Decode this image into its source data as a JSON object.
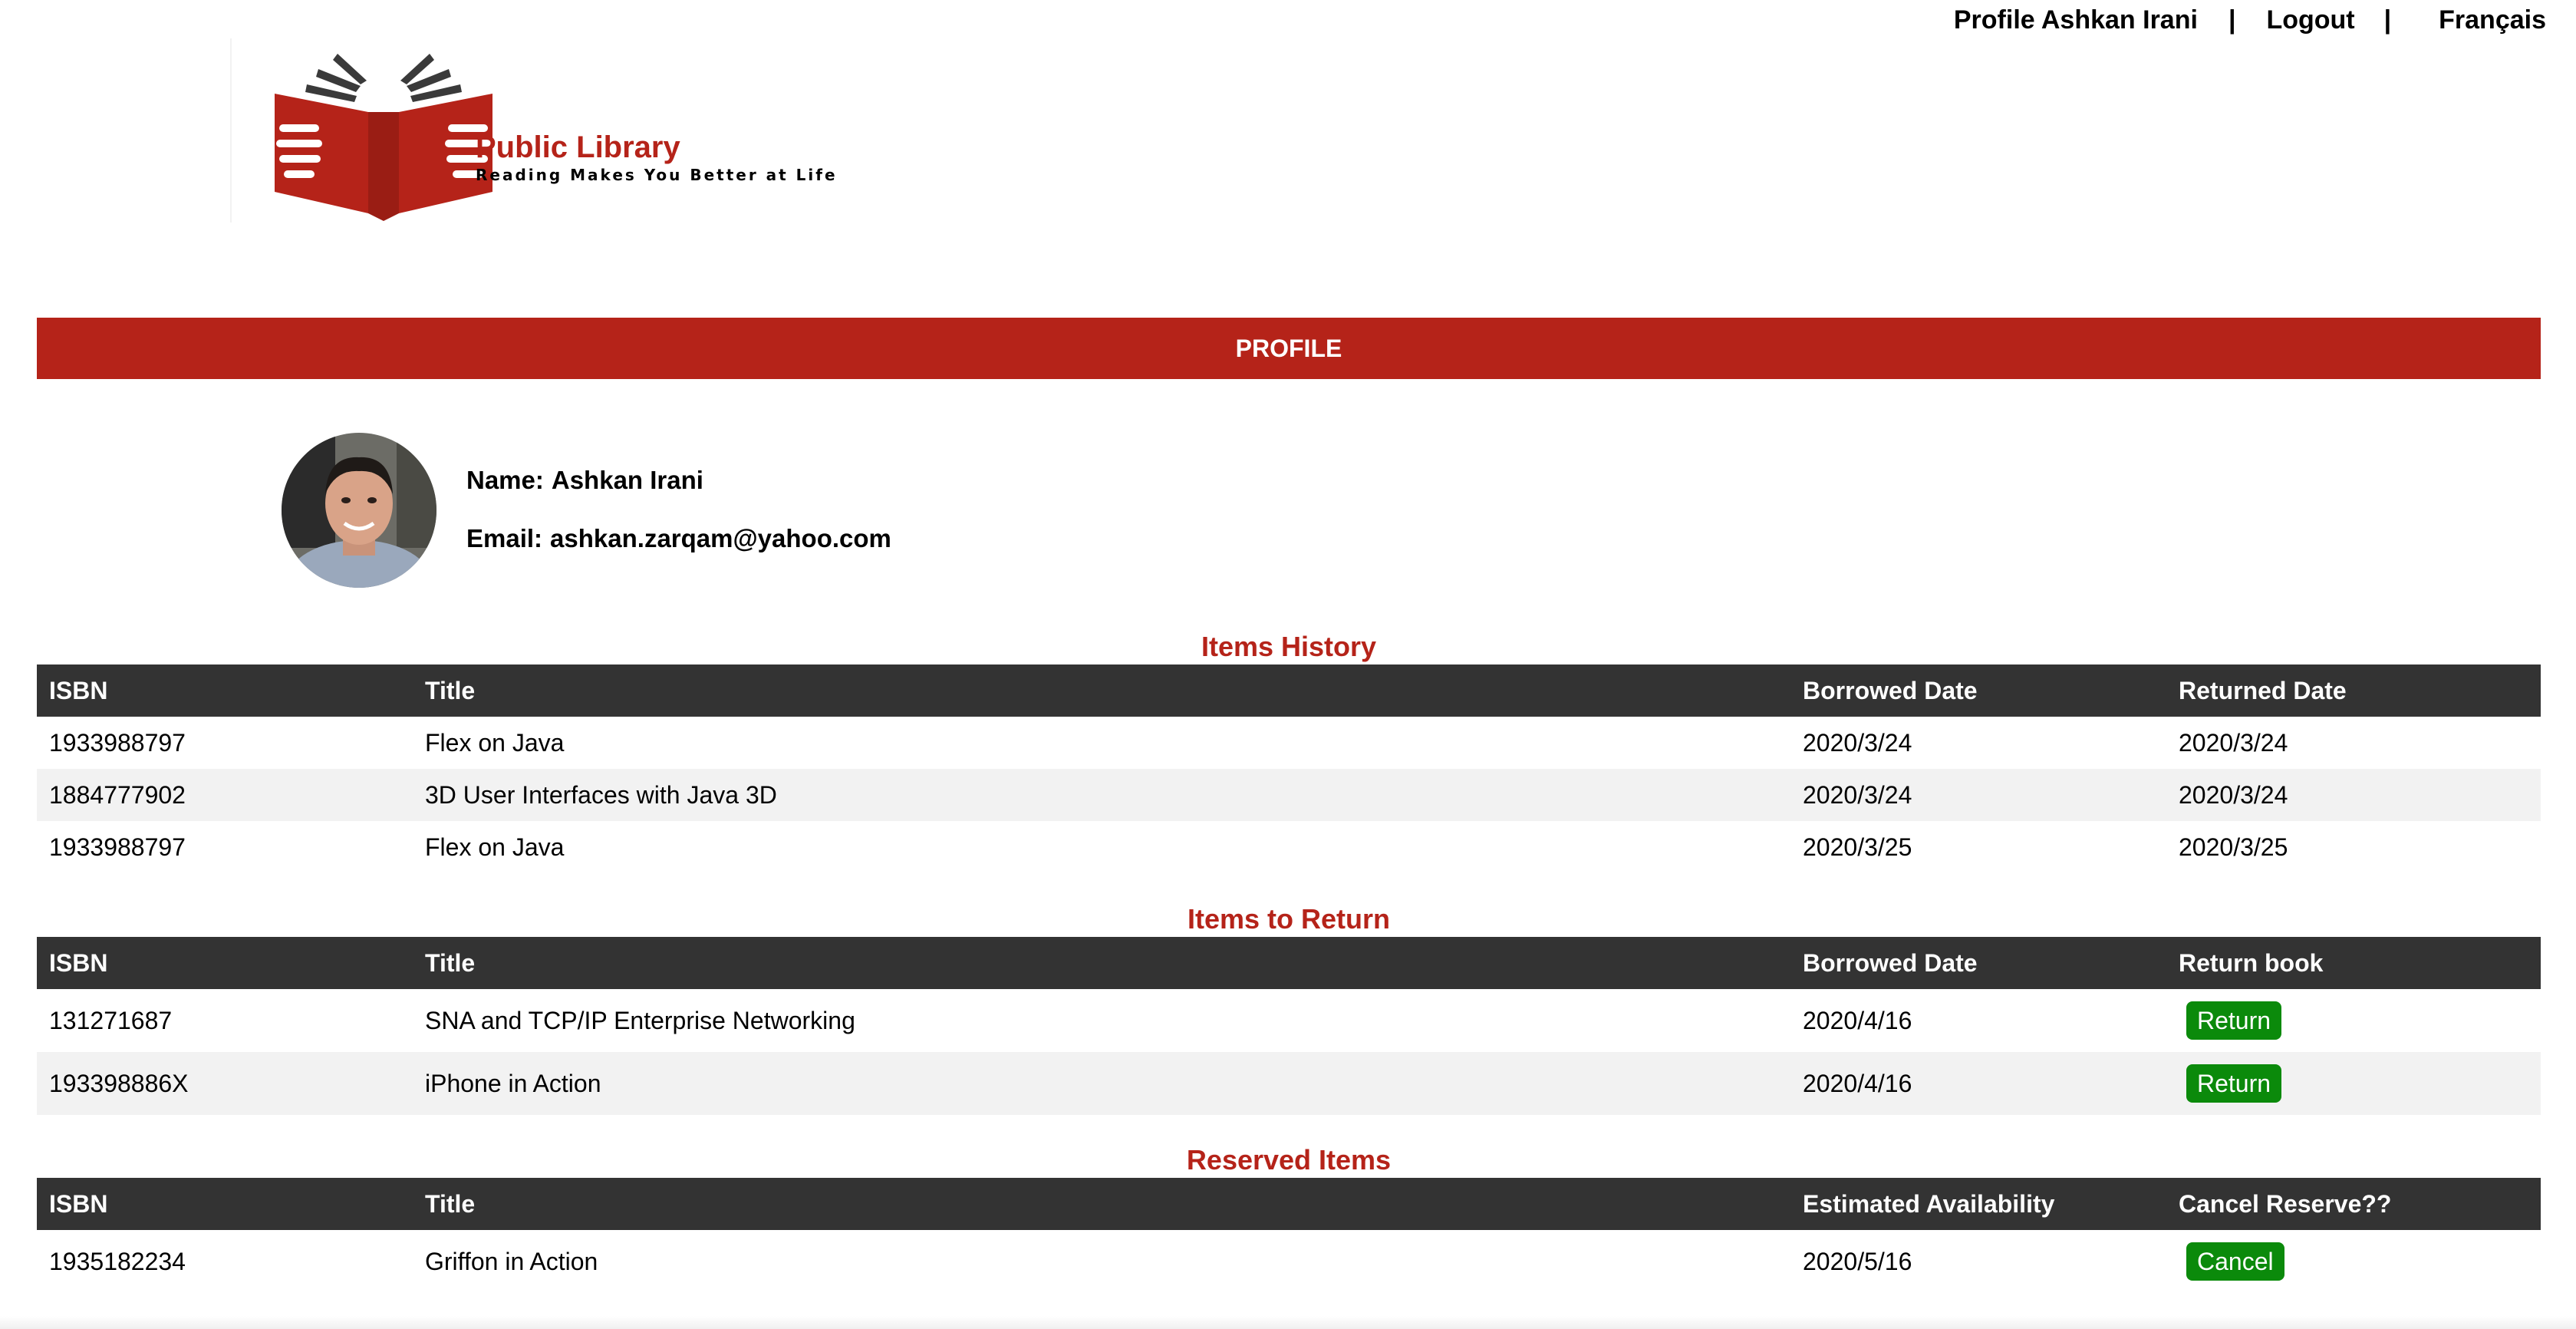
{
  "nav": {
    "profile_link": "Profile Ashkan Irani",
    "separator": "|",
    "logout": "Logout",
    "language": "Français"
  },
  "brand": {
    "name": "Public Library",
    "tagline": "Reading Makes You Better at Life",
    "color": "#b52319"
  },
  "profile_header": "PROFILE",
  "user": {
    "name_label": "Name:",
    "name": "Ashkan Irani",
    "email_label": "Email:",
    "email": "ashkan.zarqam@yahoo.com"
  },
  "history": {
    "title": "Items History",
    "headers": [
      "ISBN",
      "Title",
      "Borrowed Date",
      "Returned Date"
    ],
    "rows": [
      [
        "1933988797",
        "Flex on Java",
        "2020/3/24",
        "2020/3/24"
      ],
      [
        "1884777902",
        "3D User Interfaces with Java 3D",
        "2020/3/24",
        "2020/3/24"
      ],
      [
        "1933988797",
        "Flex on Java",
        "2020/3/25",
        "2020/3/25"
      ]
    ]
  },
  "to_return": {
    "title": "Items to Return",
    "headers": [
      "ISBN",
      "Title",
      "Borrowed Date",
      "Return book"
    ],
    "button_label": "Return",
    "rows": [
      [
        "131271687",
        "SNA and TCP/IP Enterprise Networking",
        "2020/4/16"
      ],
      [
        "193398886X",
        "iPhone in Action",
        "2020/4/16"
      ]
    ]
  },
  "reserved": {
    "title": "Reserved Items",
    "headers": [
      "ISBN",
      "Title",
      "Estimated Availability",
      "Cancel Reserve??"
    ],
    "button_label": "Cancel",
    "rows": [
      [
        "1935182234",
        "Griffon in Action",
        "2020/5/16"
      ]
    ]
  },
  "colors": {
    "accent_red": "#b52319",
    "table_header": "#333333",
    "button_green": "#0b8a0b",
    "row_alt": "#f2f2f2"
  }
}
